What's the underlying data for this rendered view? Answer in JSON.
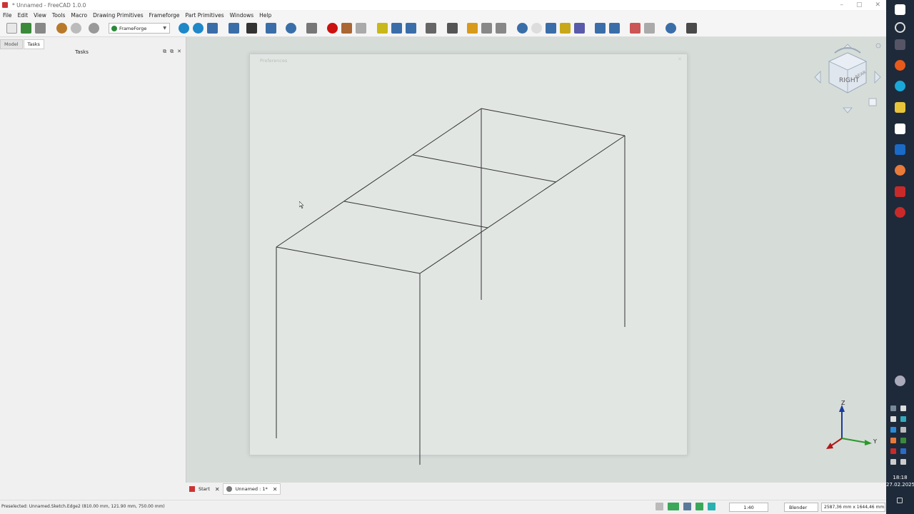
{
  "window": {
    "title": "* Unnamed - FreeCAD 1.0.0",
    "controls": [
      "–",
      "▢",
      "✕"
    ]
  },
  "menu": [
    "File",
    "Edit",
    "View",
    "Tools",
    "Macro",
    "Drawing Primitives",
    "Frameforge",
    "Part Primitives",
    "Windows",
    "Help"
  ],
  "toolbar": {
    "workbench": "FrameForge"
  },
  "panel": {
    "tabs": [
      "Model",
      "Tasks"
    ],
    "active_tab": "Tasks",
    "title": "Tasks",
    "controls": [
      "⧉",
      "⧉",
      "✕"
    ]
  },
  "dialog": {
    "title": "Preferences",
    "close": "✕"
  },
  "navcube": {
    "face_right": "RIGHT",
    "face_rear": "REAR"
  },
  "axis": {
    "z": "Z",
    "y": "Y"
  },
  "doc_tabs": [
    {
      "label": "Start"
    },
    {
      "label": "Unnamed : 1*"
    }
  ],
  "status": {
    "preselected": "Preselected: Unnamed.Sketch.Edge2 (810.00 mm, 121.90 mm, 750.00 mm)",
    "zoom": "1:40",
    "nav_style": "Blender",
    "dimensions": "2587,36 mm x 1644,46 mm"
  },
  "clock": {
    "time": "18:18",
    "date": "27.02.2025"
  },
  "colors": {
    "accent_red": "#cc1111",
    "viewport": "#d6dcd8"
  }
}
